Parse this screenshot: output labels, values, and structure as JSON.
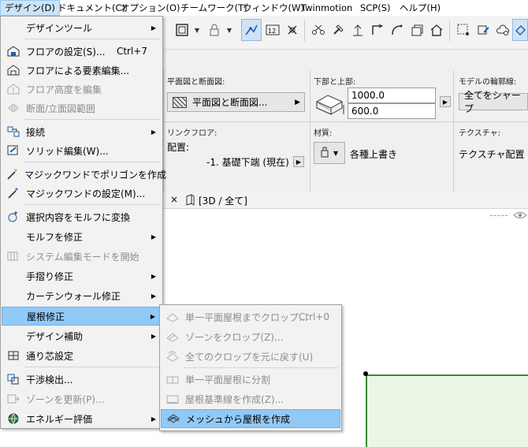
{
  "menubar": [
    {
      "label": "デザイン(D)",
      "active": true
    },
    {
      "label": "ドキュメント(C)"
    },
    {
      "label": "オプション(O)"
    },
    {
      "label": "チームワーク(T)"
    },
    {
      "label": "ウィンドウ(W)"
    },
    {
      "label": "Twinmotion"
    },
    {
      "label": "SCP(S)"
    },
    {
      "label": "ヘルプ(H)"
    }
  ],
  "infobox": {
    "plan_section_label": "平面図と断面図:",
    "plan_section_value": "平面図と断面図...",
    "top_bottom_label": "下部と上部:",
    "top_value": "1000.0",
    "bottom_value": "600.0",
    "model_outline_label": "モデルの輪郭線:",
    "model_outline_value": "全てをシャープ",
    "link_floor_label": "リンクフロア:",
    "placement_label": "配置:",
    "placement_value": "-1. 基礎下端 (現在)",
    "material_label": "材質:",
    "material_value": "各種上書き",
    "texture_label": "テクスチャ:",
    "texture_value": "テクスチャ配置"
  },
  "tabbar": {
    "close": "×",
    "tab_label": "[3D / 全て]"
  },
  "menu": {
    "items": [
      {
        "label": "デザインツール",
        "sub": true,
        "icon": "blank"
      },
      {
        "label": "フロアの設定(S)...",
        "shortcut": "Ctrl+7",
        "icon": "floor-settings-icon"
      },
      {
        "label": "フロアによる要素編集...",
        "icon": "floor-edit-icon"
      },
      {
        "label": "フロア高度を編集",
        "disabled": true,
        "icon": "floor-height-icon"
      },
      {
        "label": "断面/立面図範囲",
        "disabled": true,
        "icon": "section-range-icon"
      },
      {
        "label": "接続",
        "sub": true,
        "icon": "connect-icon"
      },
      {
        "label": "ソリッド編集(W)...",
        "icon": "solid-edit-icon"
      },
      {
        "label": "マジックワンドでポリゴンを作成",
        "icon": "magic-wand-icon"
      },
      {
        "label": "マジックワンドの設定(M)...",
        "icon": "magic-wand-settings-icon"
      },
      {
        "label": "選択内容をモルフに変換",
        "icon": "morph-convert-icon"
      },
      {
        "label": "モルフを修正",
        "sub": true,
        "icon": "blank"
      },
      {
        "label": "システム編集モードを開始",
        "disabled": true,
        "icon": "system-edit-icon"
      },
      {
        "label": "手摺り修正",
        "sub": true,
        "icon": "blank"
      },
      {
        "label": "カーテンウォール修正",
        "sub": true,
        "icon": "blank"
      },
      {
        "label": "屋根修正",
        "sub": true,
        "highlight": true,
        "icon": "blank"
      },
      {
        "label": "デザイン補助",
        "sub": true,
        "icon": "blank"
      },
      {
        "label": "通り芯設定",
        "icon": "grid-settings-icon"
      },
      {
        "label": "干渉検出...",
        "icon": "collision-icon"
      },
      {
        "label": "ゾーンを更新(P)...",
        "disabled": true,
        "icon": "zone-update-icon"
      },
      {
        "label": "エネルギー評価",
        "sub": true,
        "icon": "globe-icon"
      }
    ]
  },
  "submenu": {
    "items": [
      {
        "label": "単一平面屋根までクロップ...",
        "shortcut": "Ctrl+0",
        "disabled": true
      },
      {
        "label": "ゾーンをクロップ(Z)...",
        "disabled": true
      },
      {
        "label": "全てのクロップを元に戻す(U)",
        "disabled": true
      },
      {
        "label": "単一平面屋根に分割",
        "disabled": true
      },
      {
        "label": "屋根基準線を作成(Z)...",
        "disabled": true
      },
      {
        "label": "メッシュから屋根を作成",
        "highlight": true
      }
    ]
  },
  "colors": {
    "highlight": "#91c9f7",
    "menubar_active": "#cce4f7",
    "canvas_green": "#3a8a3a"
  }
}
